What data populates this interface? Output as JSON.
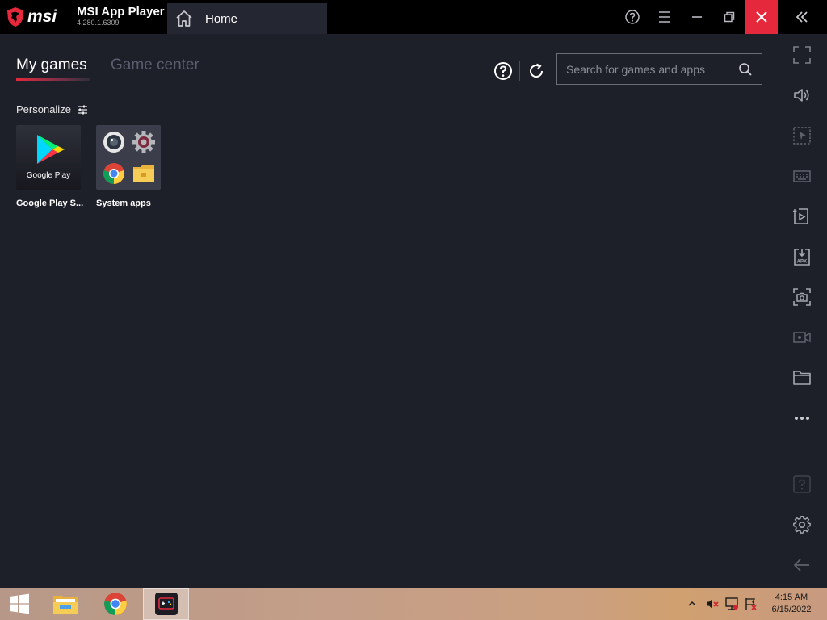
{
  "window": {
    "brand_word": "msi",
    "app_name": "MSI App Player",
    "version": "4.280.1.6309",
    "tab_label": "Home",
    "colors": {
      "accent": "#e5283c",
      "titlebar": "#000000",
      "background": "#1e2029"
    },
    "controls": [
      "help-icon",
      "menu-icon",
      "minimize-icon",
      "restore-icon",
      "close-icon",
      "collapse-sidebar-icon"
    ]
  },
  "main": {
    "tabs": [
      {
        "label": "My games",
        "active": true
      },
      {
        "label": "Game center",
        "active": false
      }
    ],
    "search": {
      "placeholder": "Search for games and apps",
      "value": ""
    },
    "personalize_label": "Personalize",
    "apps": [
      {
        "label": "Google Play S...",
        "thumb_text": "Google Play",
        "icon": "google-play-icon"
      },
      {
        "label": "System apps",
        "icon": "system-apps-folder-icon"
      }
    ]
  },
  "sidebar": {
    "buttons": [
      "fullscreen-icon",
      "volume-icon",
      "screen-select-icon",
      "keyboard-icon",
      "multi-instance-icon",
      "install-apk-icon",
      "screenshot-icon",
      "record-icon",
      "folder-icon",
      "more-icon",
      "help-icon",
      "settings-icon",
      "back-icon"
    ]
  },
  "taskbar": {
    "items": [
      "windows-start-icon",
      "file-explorer-icon",
      "chrome-icon",
      "msi-app-player-icon"
    ],
    "time": "4:15 AM",
    "date": "6/15/2022"
  }
}
